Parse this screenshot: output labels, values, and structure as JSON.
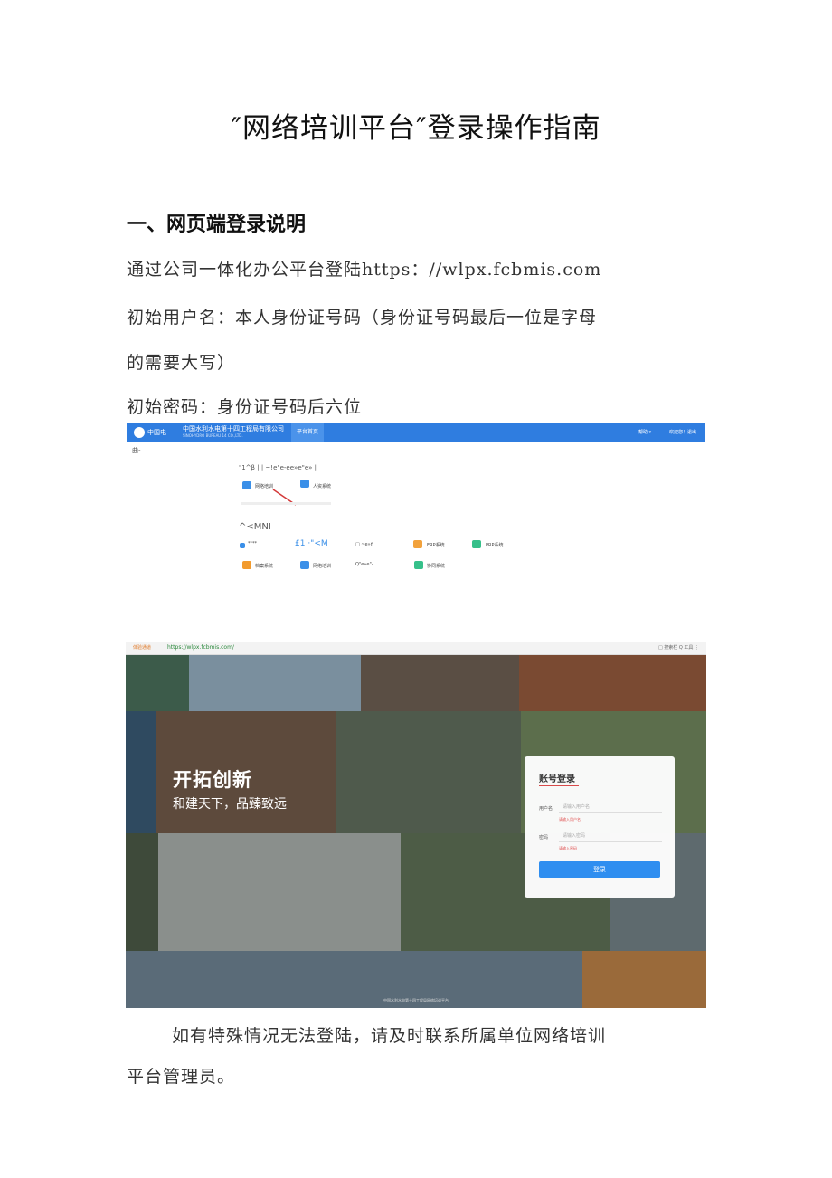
{
  "title": "″网络培训平台″登录操作指南",
  "section1": {
    "heading": "一、网页端登录说明"
  },
  "lines": {
    "line1": "通过公司一体化办公平台登陆https：//wlpx.fcbmis.com",
    "line2a": "初始用户名：本人身份证号码（身份证号码最后一位是字母",
    "line2b": "的需要大写）",
    "line3": "初始密码：身份证号码后六位",
    "note_a": "如有特殊情况无法登陆，请及时联系所属单位网络培训",
    "note_b": "平台管理员。"
  },
  "screenshot1": {
    "logo_text": "中国电建",
    "company": "中国水利水电第十四工程局有限公司",
    "company_sub": "SINOHYDRO BUREAU 14 CO.,LTD.",
    "nav_tab": "平台首页",
    "top_right_1": "帮助 ▾",
    "top_right_2": "欢迎您！退出",
    "crumb": "曲-",
    "section_a": "\"1^β | | ~!e\"e-ee»e\"e» |",
    "app_a1": "网络培训",
    "app_a2": "人资系统",
    "section_b": "^<MNI",
    "row1": [
      "****",
      "£1 ·\"<M",
      "□ ~e»ñ",
      "ERP系统",
      "PRP系统"
    ],
    "row2": [
      "档案系统",
      "网络培训",
      "Q\"e»e\"-",
      "协同系统"
    ]
  },
  "screenshot2": {
    "browser_tag": "体验通道",
    "url": "https://wlpx.fcbmis.com/",
    "browser_right": "□ 搜索栏 Q 工具 ⋮",
    "slogan_title": "开拓创新",
    "slogan_sub": "和建天下，品臻致远",
    "login_title": "账号登录",
    "username_label": "用户名",
    "username_placeholder": "请输入用户名",
    "username_error": "请输入用户名",
    "password_label": "密码",
    "password_placeholder": "请输入密码",
    "password_error": "请输入密码",
    "login_button": "登录",
    "footer": "中国水利水电第十四工程局网络培训平台"
  },
  "colors": {
    "brand_blue": "#2f7de0",
    "login_blue": "#2f8ef0",
    "error_red": "#e05050"
  }
}
